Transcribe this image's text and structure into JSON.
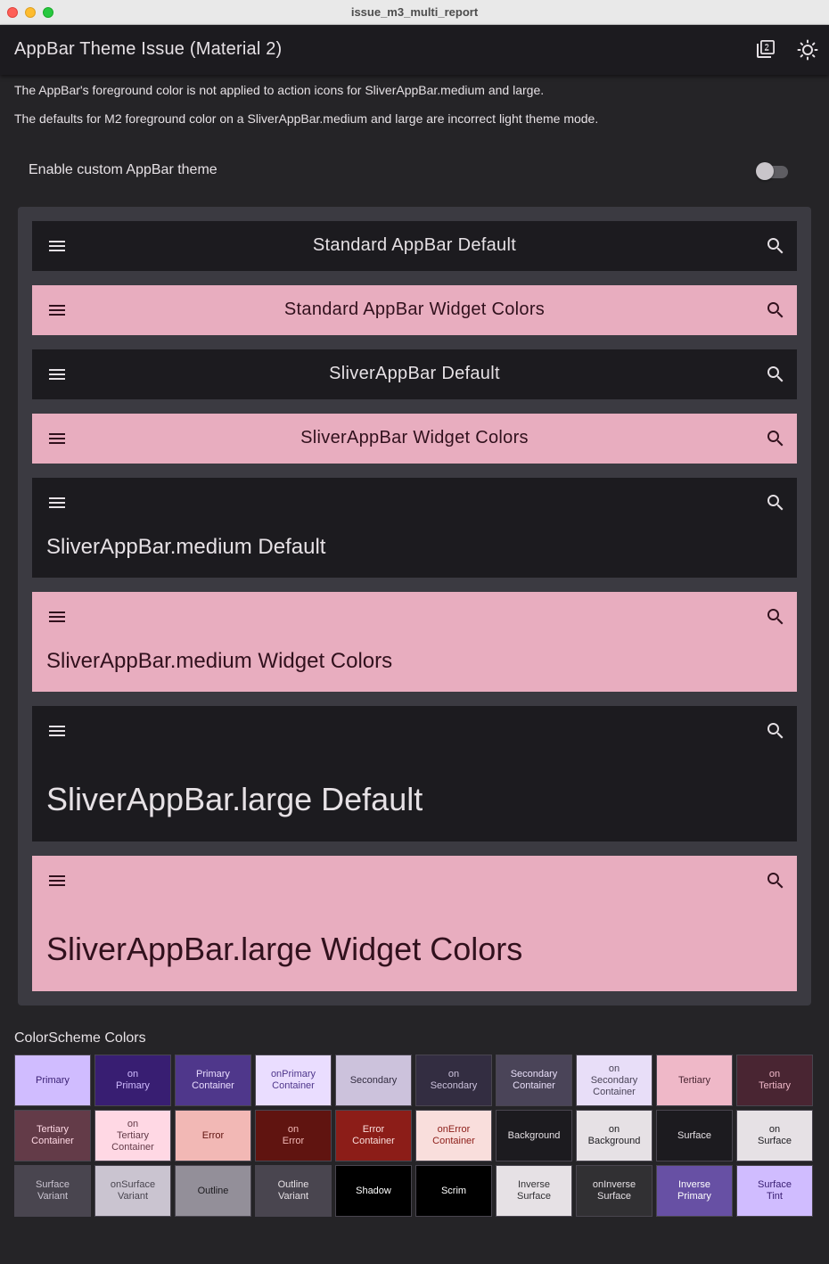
{
  "window": {
    "title": "issue_m3_multi_report"
  },
  "appbar": {
    "title": "AppBar Theme Issue (Material 2)",
    "actions": [
      "material-version-icon",
      "theme-brightness-icon"
    ]
  },
  "description": [
    "The AppBar's foreground color is not applied to action icons for SliverAppBar.medium and large.",
    "The defaults for M2 foreground color on a SliverAppBar.medium and large are incorrect light theme mode."
  ],
  "toggle": {
    "label": "Enable custom AppBar theme",
    "value": false
  },
  "bars": [
    {
      "title": "Standard AppBar Default",
      "style": "dark",
      "size": "standard"
    },
    {
      "title": "Standard AppBar Widget Colors",
      "style": "pink",
      "size": "standard"
    },
    {
      "title": "SliverAppBar Default",
      "style": "dark",
      "size": "standard"
    },
    {
      "title": "SliverAppBar Widget Colors",
      "style": "pink",
      "size": "standard"
    },
    {
      "title": "SliverAppBar.medium Default",
      "style": "dark",
      "size": "medium"
    },
    {
      "title": "SliverAppBar.medium Widget Colors",
      "style": "pink",
      "size": "medium"
    },
    {
      "title": "SliverAppBar.large Default",
      "style": "dark",
      "size": "large"
    },
    {
      "title": "SliverAppBar.large Widget Colors",
      "style": "pink",
      "size": "large"
    }
  ],
  "color_scheme": {
    "title": "ColorScheme Colors",
    "swatches": [
      {
        "label": "Primary",
        "bg": "#d0bcff",
        "fg": "#381e72"
      },
      {
        "label": "on\nPrimary",
        "bg": "#381e72",
        "fg": "#d0bcff"
      },
      {
        "label": "Primary\nContainer",
        "bg": "#4f378b",
        "fg": "#eaddff"
      },
      {
        "label": "onPrimary\nContainer",
        "bg": "#eaddff",
        "fg": "#4f378b"
      },
      {
        "label": "Secondary",
        "bg": "#ccc2dc",
        "fg": "#332d41"
      },
      {
        "label": "on\nSecondary",
        "bg": "#332d41",
        "fg": "#ccc2dc"
      },
      {
        "label": "Secondary\nContainer",
        "bg": "#4a4458",
        "fg": "#e8def8"
      },
      {
        "label": "on\nSecondary\nContainer",
        "bg": "#e8def8",
        "fg": "#4a4458"
      },
      {
        "label": "Tertiary",
        "bg": "#efb8c8",
        "fg": "#492532"
      },
      {
        "label": "on\nTertiary",
        "bg": "#492532",
        "fg": "#efb8c8"
      },
      {
        "label": "Tertiary\nContainer",
        "bg": "#633b48",
        "fg": "#ffd8e4"
      },
      {
        "label": "on\nTertiary\nContainer",
        "bg": "#ffd8e4",
        "fg": "#633b48"
      },
      {
        "label": "Error",
        "bg": "#f2b8b5",
        "fg": "#601410"
      },
      {
        "label": "on\nError",
        "bg": "#601410",
        "fg": "#f2b8b5"
      },
      {
        "label": "Error\nContainer",
        "bg": "#8c1d18",
        "fg": "#f9dedc"
      },
      {
        "label": "onError\nContainer",
        "bg": "#f9dedc",
        "fg": "#8c1d18"
      },
      {
        "label": "Background",
        "bg": "#1c1b1f",
        "fg": "#e6e1e5"
      },
      {
        "label": "on\nBackground",
        "bg": "#e6e1e5",
        "fg": "#1c1b1f"
      },
      {
        "label": "Surface",
        "bg": "#1c1b1f",
        "fg": "#e6e1e5"
      },
      {
        "label": "on\nSurface",
        "bg": "#e6e1e5",
        "fg": "#1c1b1f"
      },
      {
        "label": "Surface\nVariant",
        "bg": "#49454f",
        "fg": "#cac4d0"
      },
      {
        "label": "onSurface\nVariant",
        "bg": "#cac4d0",
        "fg": "#49454f"
      },
      {
        "label": "Outline",
        "bg": "#938f99",
        "fg": "#1c1b1f"
      },
      {
        "label": "Outline\nVariant",
        "bg": "#49454f",
        "fg": "#e6e1e5"
      },
      {
        "label": "Shadow",
        "bg": "#000000",
        "fg": "#ffffff"
      },
      {
        "label": "Scrim",
        "bg": "#000000",
        "fg": "#ffffff"
      },
      {
        "label": "Inverse\nSurface",
        "bg": "#e6e1e5",
        "fg": "#313033"
      },
      {
        "label": "onInverse\nSurface",
        "bg": "#313033",
        "fg": "#e6e1e5"
      },
      {
        "label": "Inverse\nPrimary",
        "bg": "#6750a4",
        "fg": "#ffffff"
      },
      {
        "label": "Surface\nTint",
        "bg": "#d0bcff",
        "fg": "#381e72"
      }
    ]
  }
}
